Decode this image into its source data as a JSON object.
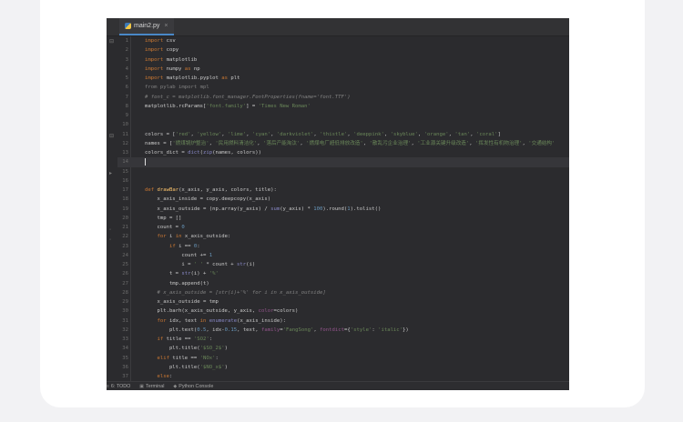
{
  "editor": {
    "tab_label": "main2.py",
    "tab_close": "×",
    "lines": [
      {
        "n": "1",
        "text": "import csv"
      },
      {
        "n": "2",
        "text": "import copy"
      },
      {
        "n": "3",
        "text": "import matplotlib"
      },
      {
        "n": "4",
        "text": "import numpy as np"
      },
      {
        "n": "5",
        "text": "import matplotlib.pyplot as plt"
      },
      {
        "n": "6",
        "text": "from pylab import mpl"
      },
      {
        "n": "7",
        "text": "# font_c = matplotlib.font_manager.FontProperties(fname='font.TTF')"
      },
      {
        "n": "8",
        "text": "matplotlib.rcParams['font.family'] = 'Times New Roman'"
      },
      {
        "n": "9",
        "text": ""
      },
      {
        "n": "10",
        "text": ""
      },
      {
        "n": "11",
        "text": "colors = ['red', 'yellow', 'lime', 'cyan', 'darkviolet', 'thistle', 'deeppink', 'skyblue', 'orange', 'tan', 'coral']"
      },
      {
        "n": "12",
        "text": "names = ['燃煤锅炉整治', '民用燃料清洁化', '落后产能淘汰', '燃煤电厂超低排放改造', '散乱污企业治理', '工业源关键升级改造', '挥发性有机物治理', '交通结构'"
      },
      {
        "n": "13",
        "text": "colors_dict = dict(zip(names, colors))"
      },
      {
        "n": "14",
        "text": ""
      },
      {
        "n": "15",
        "text": ""
      },
      {
        "n": "16",
        "text": ""
      },
      {
        "n": "17",
        "text": "def drawBar(x_axis, y_axis, colors, title):"
      },
      {
        "n": "18",
        "text": "    x_axis_inside = copy.deepcopy(x_axis)"
      },
      {
        "n": "19",
        "text": "    x_axis_outside = (np.array(y_axis) / sum(y_axis) * 100).round(1).tolist()"
      },
      {
        "n": "20",
        "text": "    tmp = []"
      },
      {
        "n": "21",
        "text": "    count = 0"
      },
      {
        "n": "22",
        "text": "    for i in x_axis_outside:"
      },
      {
        "n": "23",
        "text": "        if i == 0:"
      },
      {
        "n": "24",
        "text": "            count += 1"
      },
      {
        "n": "25",
        "text": "            i = ' ' * count + str(i)"
      },
      {
        "n": "26",
        "text": "        t = str(i) + '%'"
      },
      {
        "n": "27",
        "text": "        tmp.append(t)"
      },
      {
        "n": "28",
        "text": "    # x_axis_outside = [str(i)+'%' for i in x_axis_outside]"
      },
      {
        "n": "29",
        "text": "    x_axis_outside = tmp"
      },
      {
        "n": "30",
        "text": "    plt.barh(x_axis_outside, y_axis, color=colors)"
      },
      {
        "n": "31",
        "text": "    for idx, text in enumerate(x_axis_inside):"
      },
      {
        "n": "32",
        "text": "        plt.text(0.5, idx-0.15, text, family='FangSong', fontdict={'style': 'italic'})"
      },
      {
        "n": "33",
        "text": "    if title == 'SO2':"
      },
      {
        "n": "34",
        "text": "        plt.title('$SO_2$')"
      },
      {
        "n": "35",
        "text": "    elif title == 'NOx':"
      },
      {
        "n": "36",
        "text": "        plt.title('$NO_x$')"
      },
      {
        "n": "37",
        "text": "    else:"
      }
    ]
  },
  "statusbar": {
    "todo": "6: TODO",
    "terminal": "Terminal",
    "console": "Python Console"
  },
  "colors": {
    "keyword": "#cc7832",
    "string": "#6a8759",
    "comment": "#808080",
    "function": "#ffc66d",
    "number": "#6897bb",
    "param": "#94558d"
  }
}
